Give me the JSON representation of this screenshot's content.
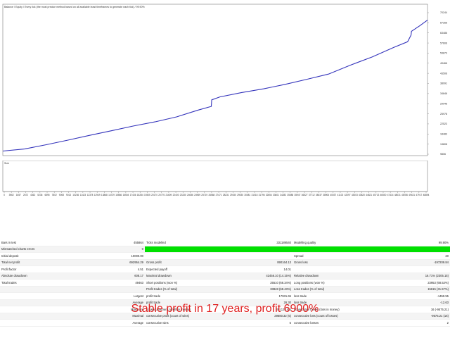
{
  "graph": {
    "legend": "Balance / Equity / Every tick (the most precise method based on all available least timeframes to generate each tick) / 99.90%",
    "equity_label": "Size",
    "y_ticks": [
      "70244",
      "67266",
      "63486",
      "57606",
      "53873",
      "49466",
      "43506",
      "38991",
      "34846",
      "29946",
      "25978",
      "22523",
      "18483",
      "13808",
      "9806"
    ],
    "x_ticks": [
      "0",
      "3962",
      "1657",
      "2672",
      "4362",
      "5236",
      "6595",
      "7802",
      "9008",
      "9013",
      "10236",
      "11423",
      "12378",
      "12949",
      "13868",
      "14729",
      "15586",
      "16504",
      "17436",
      "18284",
      "19305",
      "20170",
      "20776",
      "21609",
      "22400",
      "23330",
      "24086",
      "24969",
      "25719",
      "26568",
      "27471",
      "28231",
      "29150",
      "29530",
      "30081",
      "31018",
      "31796",
      "32654",
      "33601",
      "34282",
      "35088",
      "35947",
      "36527",
      "37712",
      "38037",
      "38906",
      "40037",
      "41102",
      "42097",
      "43003",
      "43820",
      "44821",
      "45713",
      "46500",
      "47414",
      "48031",
      "48786",
      "49431",
      "47917",
      "48894"
    ]
  },
  "chart_data": {
    "type": "line",
    "title": "",
    "xlabel": "",
    "ylabel": "",
    "series": [
      {
        "name": "Balance",
        "color": "#3333bb",
        "x": [
          0,
          2500,
          5000,
          7500,
          10000,
          12500,
          15000,
          17500,
          20000,
          22500,
          24000,
          24050,
          25000,
          27500,
          30000,
          32500,
          35000,
          37500,
          40000,
          42500,
          45000,
          46600,
          47000,
          47050,
          48000,
          48894
        ],
        "y": [
          10000,
          10900,
          12800,
          14800,
          16900,
          18900,
          21000,
          22800,
          25000,
          28000,
          29600,
          32500,
          33800,
          35700,
          37300,
          39300,
          41500,
          43800,
          47700,
          51300,
          55500,
          58000,
          60900,
          62600,
          65000,
          67500
        ]
      }
    ],
    "ylim": [
      8000,
      72000
    ],
    "xlim": [
      0,
      48894
    ]
  },
  "report": {
    "rows": [
      [
        "Bars in test",
        "455864",
        "Ticks modelled",
        "331189540",
        "Modelling quality",
        "99.90%"
      ],
      [
        "Mismatched charts errors",
        "0",
        "",
        "",
        "",
        ""
      ],
      [
        "Initial deposit",
        "10000.00",
        "",
        "",
        "Spread",
        "20"
      ],
      [
        "Total net profit",
        "692954.29",
        "Gross profit",
        "890164.13",
        "Gross loss",
        "-197209.84"
      ],
      [
        "Profit factor",
        "4.51",
        "Expected payoff",
        "14.01",
        "",
        ""
      ],
      [
        "Absolute drawdown",
        "608.17",
        "Maximal drawdown",
        "42456.10 (14.15%)",
        "Relative drawdown",
        "16.71% (2305.15)"
      ],
      [
        "Total trades",
        "49463",
        "Short positions (won %)",
        "25510 (68.34%)",
        "Long positions (won %)",
        "23953 (68.53%)"
      ],
      [
        "",
        "",
        "Profit trades (% of total)",
        "33848 (68.43%)",
        "Loss trades (% of total)",
        "15615 (31.57%)"
      ],
      [
        "",
        "Largest",
        "profit trade",
        "17931.65",
        "loss trade",
        "-1459.55"
      ],
      [
        "",
        "Average",
        "profit trade",
        "26.30",
        "loss trade",
        "-12.63"
      ],
      [
        "",
        "Maximum",
        "consecutive wins (profit in money)",
        "29 (135.45)",
        "consecutive losses (loss in money)",
        "16 (-9575.21)"
      ],
      [
        "",
        "Maximal",
        "consecutive profit (count of wins)",
        "29680.32 (5)",
        "consecutive loss (count of losses)",
        "-9575.21 (16)"
      ],
      [
        "",
        "Average",
        "consecutive wins",
        "5",
        "consecutive losses",
        "2"
      ]
    ]
  },
  "caption": "Stable profit in 17 years, profit 6900%"
}
